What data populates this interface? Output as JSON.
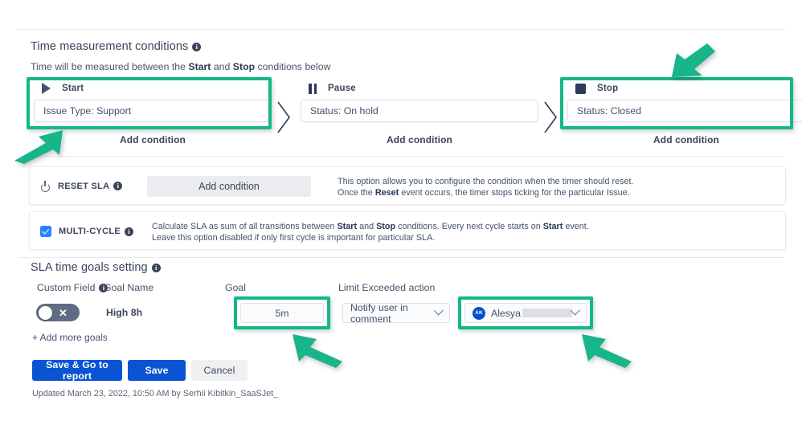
{
  "section1": {
    "title": "Time measurement conditions",
    "subtitle_parts": [
      "Time will be measured between the ",
      "Start",
      " and ",
      "Stop",
      " conditions below"
    ],
    "columns": [
      {
        "icon": "play-icon",
        "label": "Start",
        "condition_value": "Issue Type: Support",
        "add_label": "Add condition",
        "highlighted": true
      },
      {
        "icon": "pause-icon",
        "label": "Pause",
        "condition_value": "Status: On hold",
        "add_label": "Add condition",
        "highlighted": false
      },
      {
        "icon": "stop-icon",
        "label": "Stop",
        "condition_value": "Status: Closed",
        "add_label": "Add condition",
        "highlighted": true
      }
    ]
  },
  "reset_sla": {
    "icon": "power-icon",
    "label": "RESET SLA",
    "button_label": "Add condition",
    "desc_line1": "This option allows you to configure the condition when the timer should reset.",
    "desc_line2_a": "Once the ",
    "desc_line2_b": "Reset",
    "desc_line2_c": " event occurs, the timer stops ticking for the particular Issue."
  },
  "multi_cycle": {
    "label": "MULTI-CYCLE",
    "checked": true,
    "desc_line1_a": "Calculate SLA as sum of all transitions between ",
    "desc_line1_b": "Start",
    "desc_line1_c": " and ",
    "desc_line1_d": "Stop",
    "desc_line1_e": " conditions. Every next cycle starts on ",
    "desc_line1_f": "Start",
    "desc_line1_g": " event.",
    "desc_line2": "Leave this option disabled if only first cycle is important for particular SLA."
  },
  "section2": {
    "title": "SLA time goals setting",
    "headers": {
      "custom_field": "Custom Field",
      "goal_name": "Goal Name",
      "goal": "Goal",
      "limit_exceeded": "Limit Exceeded action"
    },
    "goal_row": {
      "toggle_on": false,
      "toggle_mark": "✕",
      "name": "High 8h",
      "goal_value": "5m",
      "action_value": "Notify user in comment",
      "user_initials": "AK",
      "user_name": "Alesya",
      "user_name_redacted": true
    },
    "add_more_label": "+ Add more goals"
  },
  "footer": {
    "save_go_label": "Save & Go to report",
    "save_label": "Save",
    "cancel_label": "Cancel",
    "updated_text": "Updated March 23, 2022, 10:50 AM by Serhii Kibitkin_SaaSJet_"
  },
  "annotations": {
    "highlight_color": "#14B789",
    "arrows": [
      {
        "name": "arrow-start-condition",
        "direction": "up-right"
      },
      {
        "name": "arrow-stop-condition",
        "direction": "down-left"
      },
      {
        "name": "arrow-goal-value",
        "direction": "up-left"
      },
      {
        "name": "arrow-notify-user",
        "direction": "up-left"
      }
    ]
  }
}
